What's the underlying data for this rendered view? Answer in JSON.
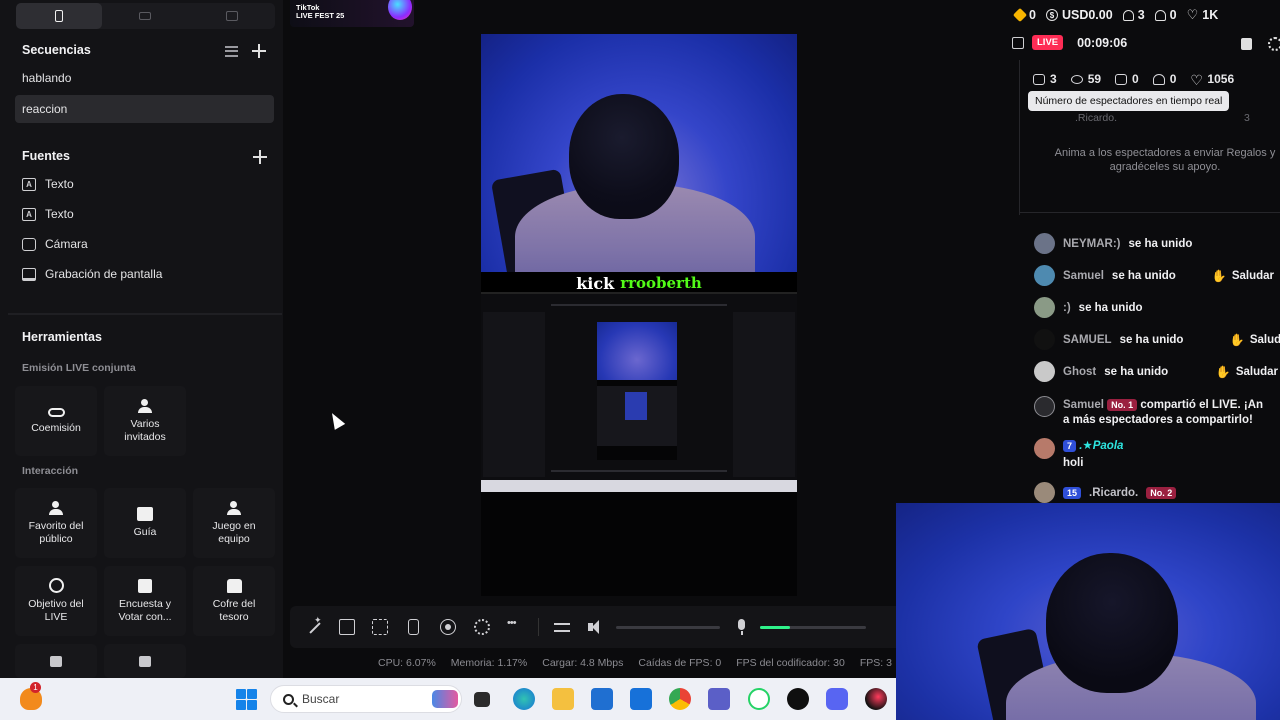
{
  "view_tabs": [
    "vertical",
    "horizontal",
    "mixed"
  ],
  "sequences": {
    "title": "Secuencias",
    "items": [
      "hablando",
      "reaccion"
    ],
    "selected": "reaccion"
  },
  "sources": {
    "title": "Fuentes",
    "items": [
      {
        "label": "Texto",
        "icon": "text-icon"
      },
      {
        "label": "Texto",
        "icon": "text-icon"
      },
      {
        "label": "Cámara",
        "icon": "camera-icon"
      },
      {
        "label": "Grabación de pantalla",
        "icon": "screen-icon"
      }
    ]
  },
  "tools": {
    "title": "Herramientas",
    "live_section": "Emisión LIVE conjunta",
    "interaction_section": "Interacción",
    "live_items": [
      {
        "label": "Coemisión",
        "icon": "link-icon"
      },
      {
        "label": "Varios invitados",
        "icon": "people-icon"
      }
    ],
    "interaction_items": [
      {
        "label": "Favorito del público",
        "icon": "star-people-icon"
      },
      {
        "label": "Guía",
        "icon": "guide-icon"
      },
      {
        "label": "Juego en equipo",
        "icon": "team-icon"
      },
      {
        "label": "Objetivo del LIVE",
        "icon": "target-icon"
      },
      {
        "label": "Encuesta y Votar con...",
        "icon": "poll-icon"
      },
      {
        "label": "Cofre del tesoro",
        "icon": "chest-icon"
      }
    ]
  },
  "badge": {
    "line1": "TikTok",
    "line2": "LIVE FEST 25"
  },
  "overlay": {
    "kick": "kick",
    "user": "rrooberth"
  },
  "stats": {
    "cpu": "CPU: 6.07%",
    "memory": "Memoria: 1.17%",
    "upload": "Cargar: 4.8 Mbps",
    "fps_drops": "Caídas de FPS: 0",
    "encoder_fps": "FPS del codificador: 30",
    "fps": "FPS: 3"
  },
  "audio": {
    "speaker_level": 0.0,
    "mic_level": 0.28
  },
  "taskbar": {
    "search_placeholder": "Buscar",
    "notification_count": "1"
  },
  "top_stats": {
    "coins": "0",
    "usd": "USD0.00",
    "viewers": "3",
    "follows": "0",
    "likes": "1K"
  },
  "live": {
    "badge": "LIVE",
    "timer": "00:09:06"
  },
  "metrics": {
    "viewers": "3",
    "views": "59",
    "gifts": "0",
    "new_followers": "0",
    "likes": "1056"
  },
  "tooltip": "Número de espectadores en tiempo real",
  "faded": {
    "name": ".Ricardo.",
    "count": "3"
  },
  "hint": "Anima a los espectadores a enviar Regalos y agradéceles su apoyo.",
  "chat": {
    "saludar_label": "Saludar",
    "rows": [
      {
        "name": "NEYMAR:)",
        "msg": "se ha unido",
        "saludar": false
      },
      {
        "name": "Samuel",
        "msg": "se ha unido",
        "saludar": true
      },
      {
        "name": ":)",
        "msg": "se ha unido",
        "saludar": false
      },
      {
        "name": "SAMUEL",
        "msg": "se ha unido",
        "saludar": true
      },
      {
        "name": "Ghost",
        "msg": "se ha unido",
        "saludar": true
      }
    ],
    "share": {
      "name": "Samuel",
      "badge": "No. 1",
      "msg1": "compartió el LIVE. ¡An",
      "msg2": "a más espectadores a compartirlo!"
    },
    "paola": {
      "level": "7",
      "name": ".★Paola",
      "msg": "holi"
    },
    "ricardo": {
      "level": "15",
      "name": ".Ricardo.",
      "badge": "No. 2"
    }
  },
  "colors": {
    "accent_live": "#fe2c55",
    "kick_green": "#53fc18",
    "mic_green": "#2ff28a"
  }
}
